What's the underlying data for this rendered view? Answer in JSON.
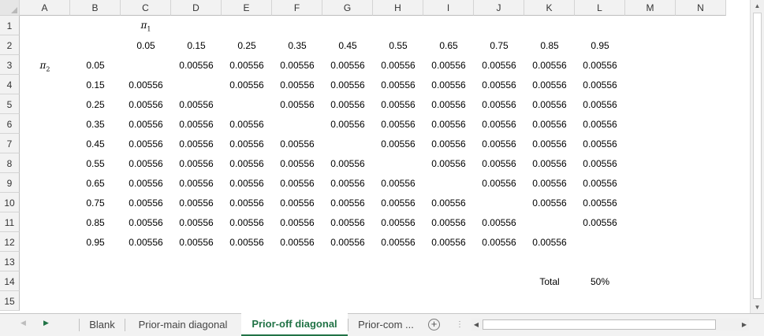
{
  "columns": [
    "A",
    "B",
    "C",
    "D",
    "E",
    "F",
    "G",
    "H",
    "I",
    "J",
    "K",
    "L",
    "M",
    "N"
  ],
  "rows": [
    "1",
    "2",
    "3",
    "4",
    "5",
    "6",
    "7",
    "8",
    "9",
    "10",
    "11",
    "12",
    "13",
    "14",
    "15"
  ],
  "labels": {
    "pi1": "π",
    "pi1_sub": "1",
    "pi2": "π",
    "pi2_sub": "2"
  },
  "header_values": [
    "0.05",
    "0.15",
    "0.25",
    "0.35",
    "0.45",
    "0.55",
    "0.65",
    "0.75",
    "0.85",
    "0.95"
  ],
  "row_values": [
    "0.05",
    "0.15",
    "0.25",
    "0.35",
    "0.45",
    "0.55",
    "0.65",
    "0.75",
    "0.85",
    "0.95"
  ],
  "cell_value": "0.00556",
  "total": {
    "label": "Total",
    "value": "50%"
  },
  "tabs": [
    {
      "label": "Blank",
      "active": false
    },
    {
      "label": "Prior-main diagonal",
      "active": false
    },
    {
      "label": "Prior-off diagonal",
      "active": true
    },
    {
      "label": "Prior-com ...",
      "active": false
    }
  ],
  "icons": {
    "nav_prev": "triangle-left-icon",
    "nav_next": "triangle-right-icon",
    "add_sheet": "plus-circle-icon",
    "splitter": "vertical-dots-icon"
  },
  "colors": {
    "accent": "#217346"
  }
}
